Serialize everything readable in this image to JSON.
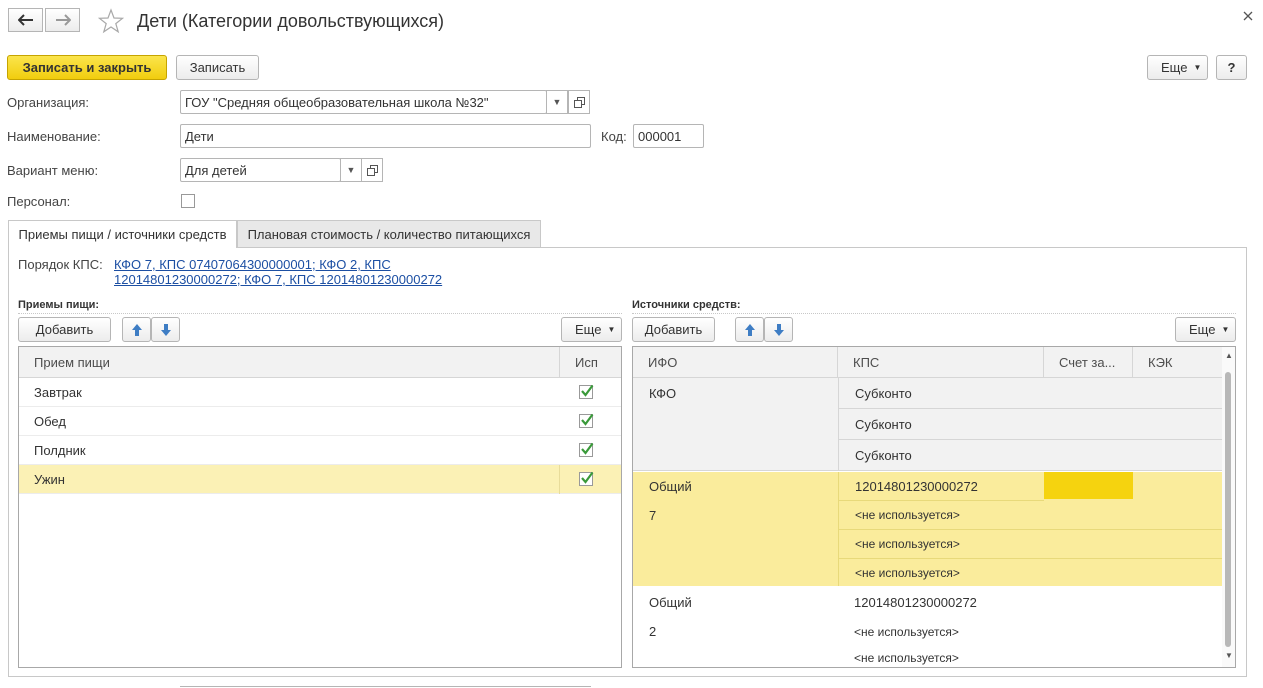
{
  "window": {
    "title": "Дети (Категории довольствующихся)"
  },
  "toolbar": {
    "save_close_label": "Записать и закрыть",
    "save_label": "Записать",
    "more_label": "Еще",
    "help_label": "?"
  },
  "form": {
    "organization_label": "Организация:",
    "organization_value": "ГОУ \"Средняя общеобразовательная школа №32\"",
    "name_label": "Наименование:",
    "name_value": "Дети",
    "code_label": "Код:",
    "code_value": "000001",
    "menu_variant_label": "Вариант меню:",
    "menu_variant_value": "Для детей",
    "personnel_label": "Персонал:",
    "personnel_checked": false
  },
  "tabs": [
    {
      "label": "Приемы пищи / источники средств",
      "active": true
    },
    {
      "label": "Плановая стоимость / количество питающихся",
      "active": false
    }
  ],
  "kps_order": {
    "label": "Порядок КПС:",
    "line1": "КФО 7, КПС 07407064300000001; КФО 2, КПС",
    "line2": "12014801230000272; КФО 7, КПС 12014801230000272"
  },
  "meals": {
    "title": "Приемы пищи:",
    "add_label": "Добавить",
    "more_label": "Еще",
    "columns": [
      "Прием пищи",
      "Исп"
    ],
    "rows": [
      {
        "name": "Завтрак",
        "used": true
      },
      {
        "name": "Обед",
        "used": true
      },
      {
        "name": "Полдник",
        "used": true
      },
      {
        "name": "Ужин",
        "used": true,
        "selected": true
      }
    ]
  },
  "sources": {
    "title": "Источники средств:",
    "add_label": "Добавить",
    "more_label": "Еще",
    "columns": [
      "ИФО",
      "КПС",
      "Счет за...",
      "КЭК"
    ],
    "group1": {
      "ifo": "КФО",
      "kps": [
        "Субконто",
        "Субконто",
        "Субконто"
      ]
    },
    "group2": {
      "ifo1": "Общий",
      "ifo2": "7",
      "kps": "12014801230000272",
      "unused": [
        "<не используется>",
        "<не используется>",
        "<не используется>"
      ]
    },
    "group3": {
      "ifo1": "Общий",
      "ifo2": "2",
      "kps": "12014801230000272",
      "unused": [
        "<не используется>",
        "<не используется>"
      ]
    }
  },
  "colors": {
    "accent_yellow": "#f5d30f",
    "selected_row": "#fbf1b5",
    "selection_band": "#faec9c",
    "link": "#1c4fa3",
    "check_green": "#3a9a3a"
  }
}
